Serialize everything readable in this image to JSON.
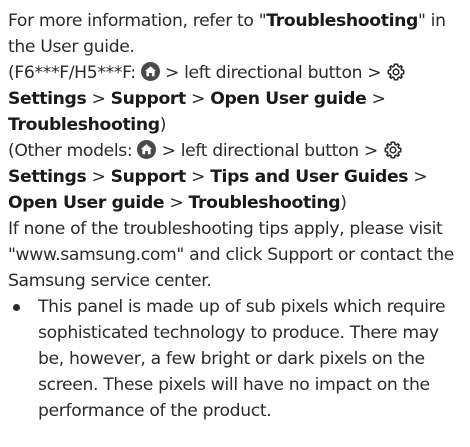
{
  "intro": {
    "before": "For more information, refer to \"",
    "troubleshooting": "Troubleshooting",
    "after": "\" in the User guide."
  },
  "path1": {
    "prefix": "(F6***F/H5***F: ",
    "left_button": " > left directional button > ",
    "settings": "Settings",
    "sep1": " > ",
    "support": "Support",
    "sep2": " > ",
    "open_user_guide": "Open User guide",
    "sep3": " > ",
    "troubleshooting": "Troubleshooting",
    "close": ")"
  },
  "path2": {
    "prefix": "(Other models: ",
    "left_button": " > left directional button > ",
    "settings": "Settings",
    "sep1": " > ",
    "support": "Support",
    "sep2": " > ",
    "tips": "Tips and User Guides",
    "sep3": " > ",
    "open_user_guide": "Open User guide",
    "sep4": " > ",
    "troubleshooting": "Troubleshooting",
    "close": ")"
  },
  "contact": {
    "text": "If none of the troubleshooting tips apply, please visit \"www.samsung.com\" and click Support or contact the Samsung service center."
  },
  "bullets": [
    {
      "text": "This panel is made up of sub pixels which require sophisticated technology to produce. There may be, however, a few bright or dark pixels on the screen. These pixels will have no impact on the performance of the product."
    }
  ],
  "icons": {
    "home": "home-icon",
    "settings": "gear-icon"
  }
}
